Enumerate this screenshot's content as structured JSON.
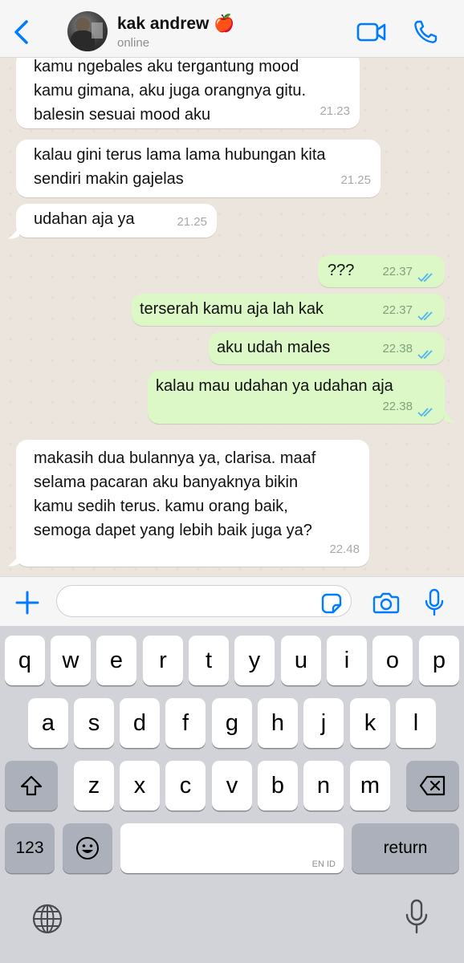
{
  "header": {
    "contact_name": "kak andrew 🍎",
    "status": "online"
  },
  "messages": [
    {
      "dir": "in",
      "lines": [
        "kamu ngebales aku tergantung mood",
        "kamu gimana, aku juga orangnya gitu.",
        "balesin sesuai mood aku"
      ],
      "time": "21.23"
    },
    {
      "dir": "in",
      "lines": [
        "kalau gini terus lama lama hubungan kita",
        "sendiri makin gajelas"
      ],
      "time": "21.25"
    },
    {
      "dir": "in",
      "lines": [
        "udahan aja ya"
      ],
      "time": "21.25"
    },
    {
      "dir": "out",
      "lines": [
        "???"
      ],
      "time": "22.37",
      "read": true
    },
    {
      "dir": "out",
      "lines": [
        "terserah kamu aja lah kak"
      ],
      "time": "22.37",
      "read": true
    },
    {
      "dir": "out",
      "lines": [
        "aku udah males"
      ],
      "time": "22.38",
      "read": true
    },
    {
      "dir": "out",
      "lines": [
        "kalau mau udahan ya udahan aja"
      ],
      "time": "22.38",
      "read": true
    },
    {
      "dir": "in",
      "lines": [
        "makasih dua bulannya ya, clarisa. maaf",
        "selama pacaran aku banyaknya bikin",
        "kamu sedih terus. kamu orang baik,",
        "semoga dapet yang lebih baik juga ya?"
      ],
      "time": "22.48"
    }
  ],
  "composer": {
    "value": "",
    "placeholder": ""
  },
  "keyboard": {
    "row1": [
      "q",
      "w",
      "e",
      "r",
      "t",
      "y",
      "u",
      "i",
      "o",
      "p"
    ],
    "row2": [
      "a",
      "s",
      "d",
      "f",
      "g",
      "h",
      "j",
      "k",
      "l"
    ],
    "row3": [
      "z",
      "x",
      "c",
      "v",
      "b",
      "n",
      "m"
    ],
    "numbers_label": "123",
    "return_label": "return",
    "language_label": "EN ID"
  },
  "colors": {
    "accent": "#007AFF",
    "incoming_bubble": "#FFFFFF",
    "outgoing_bubble": "#DCF8C6",
    "chat_background": "#ECE5DD",
    "read_ticks": "#4FB6EC"
  },
  "icons": {
    "back": "chevron-left-icon",
    "video": "video-camera-icon",
    "call": "phone-icon",
    "plus": "plus-icon",
    "sticker": "sticker-icon",
    "camera": "camera-icon",
    "mic": "microphone-icon",
    "shift": "shift-icon",
    "delete": "backspace-icon",
    "emoji": "emoji-icon",
    "globe": "globe-icon",
    "dictation": "dictation-mic-icon"
  }
}
